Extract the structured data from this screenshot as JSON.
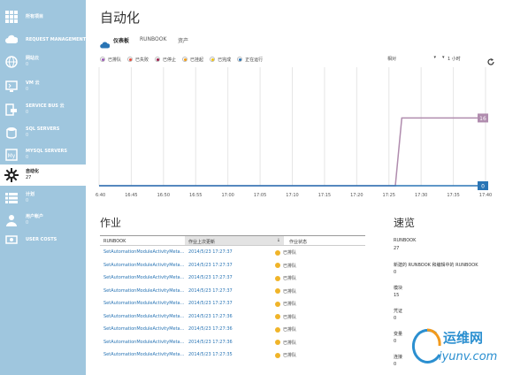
{
  "sidebar": {
    "items": [
      {
        "label": "所有项目",
        "count": "",
        "icon": "grid-icon"
      },
      {
        "label": "REQUEST MANAGEMENT",
        "count": "",
        "icon": "cloud-icon"
      },
      {
        "label": "网站云",
        "count": "0",
        "icon": "globe-icon"
      },
      {
        "label": "VM 云",
        "count": "0",
        "icon": "monitor-icon"
      },
      {
        "label": "SERVICE BUS 云",
        "count": "0",
        "icon": "service-bus-icon"
      },
      {
        "label": "SQL SERVERS",
        "count": "0",
        "icon": "database-icon"
      },
      {
        "label": "MYSQL SERVERS",
        "count": "0",
        "icon": "mysql-icon"
      },
      {
        "label": "自动化",
        "count": "27",
        "icon": "gear-icon"
      },
      {
        "label": "计划",
        "count": "0",
        "icon": "list-icon"
      },
      {
        "label": "用户帐户",
        "count": "0",
        "icon": "user-icon"
      },
      {
        "label": "USER COSTS",
        "count": "",
        "icon": "cost-icon"
      }
    ]
  },
  "header": {
    "title": "自动化",
    "tabs": [
      {
        "label": "仪表板"
      },
      {
        "label": "RUNBOOK"
      },
      {
        "label": "资产"
      }
    ]
  },
  "legend": {
    "items": [
      {
        "label": "已排队",
        "color": "#9b59b6"
      },
      {
        "label": "已失败",
        "color": "#e74c3c"
      },
      {
        "label": "已停止",
        "color": "#9b1c4a"
      },
      {
        "label": "已挂起",
        "color": "#f39c12"
      },
      {
        "label": "已完成",
        "color": "#f1c40f"
      },
      {
        "label": "正在运行",
        "color": "#2a75b5"
      }
    ]
  },
  "controls": {
    "interval_label": "相对",
    "range_label": "1 小时"
  },
  "chart_data": {
    "type": "line",
    "x": [
      "16:40",
      "16:45",
      "16:50",
      "16:55",
      "17:00",
      "17:05",
      "17:10",
      "17:15",
      "17:20",
      "17:25",
      "17:30",
      "17:35",
      "17:40"
    ],
    "series": [
      {
        "name": "已排队",
        "color": "#b08cae",
        "points": [
          [
            "16:40",
            0
          ],
          [
            "17:26",
            0
          ],
          [
            "17:27",
            16
          ],
          [
            "17:40",
            16
          ]
        ],
        "end_label": "16"
      },
      {
        "name": "正在运行",
        "color": "#2a75b5",
        "points": [
          [
            "16:40",
            0
          ],
          [
            "17:40",
            0
          ]
        ],
        "end_label": "0"
      }
    ],
    "ylim": [
      0,
      28
    ],
    "grid": true
  },
  "jobs": {
    "title": "作业",
    "columns": [
      "RUNBOOK",
      "作业上次更新",
      "作业状态"
    ],
    "rows": [
      {
        "runbook": "SetAutomationModuleActivityMeta...",
        "updated": "2014/5/23 17:27:37",
        "status": "已排队"
      },
      {
        "runbook": "SetAutomationModuleActivityMeta...",
        "updated": "2014/5/23 17:27:37",
        "status": "已排队"
      },
      {
        "runbook": "SetAutomationModuleActivityMeta...",
        "updated": "2014/5/23 17:27:37",
        "status": "已排队"
      },
      {
        "runbook": "SetAutomationModuleActivityMeta...",
        "updated": "2014/5/23 17:27:37",
        "status": "已排队"
      },
      {
        "runbook": "SetAutomationModuleActivityMeta...",
        "updated": "2014/5/23 17:27:37",
        "status": "已排队"
      },
      {
        "runbook": "SetAutomationModuleActivityMeta...",
        "updated": "2014/5/23 17:27:36",
        "status": "已排队"
      },
      {
        "runbook": "SetAutomationModuleActivityMeta...",
        "updated": "2014/5/23 17:27:36",
        "status": "已排队"
      },
      {
        "runbook": "SetAutomationModuleActivityMeta...",
        "updated": "2014/5/23 17:27:36",
        "status": "已排队"
      },
      {
        "runbook": "SetAutomationModuleActivityMeta...",
        "updated": "2014/5/23 17:27:35",
        "status": "已排队"
      }
    ]
  },
  "summary": {
    "title": "速览",
    "items": [
      {
        "label": "RUNBOOK",
        "value": "27"
      },
      {
        "label": "新建的 RUNBOOK 和编辑中的 RUNBOOK",
        "value": "0"
      },
      {
        "label": "模块",
        "value": "15"
      },
      {
        "label": "凭证",
        "value": "0"
      },
      {
        "label": "变量",
        "value": "0"
      },
      {
        "label": "连接",
        "value": "0"
      }
    ]
  },
  "watermark": {
    "text": "运维网",
    "url": "iyunv.com"
  }
}
